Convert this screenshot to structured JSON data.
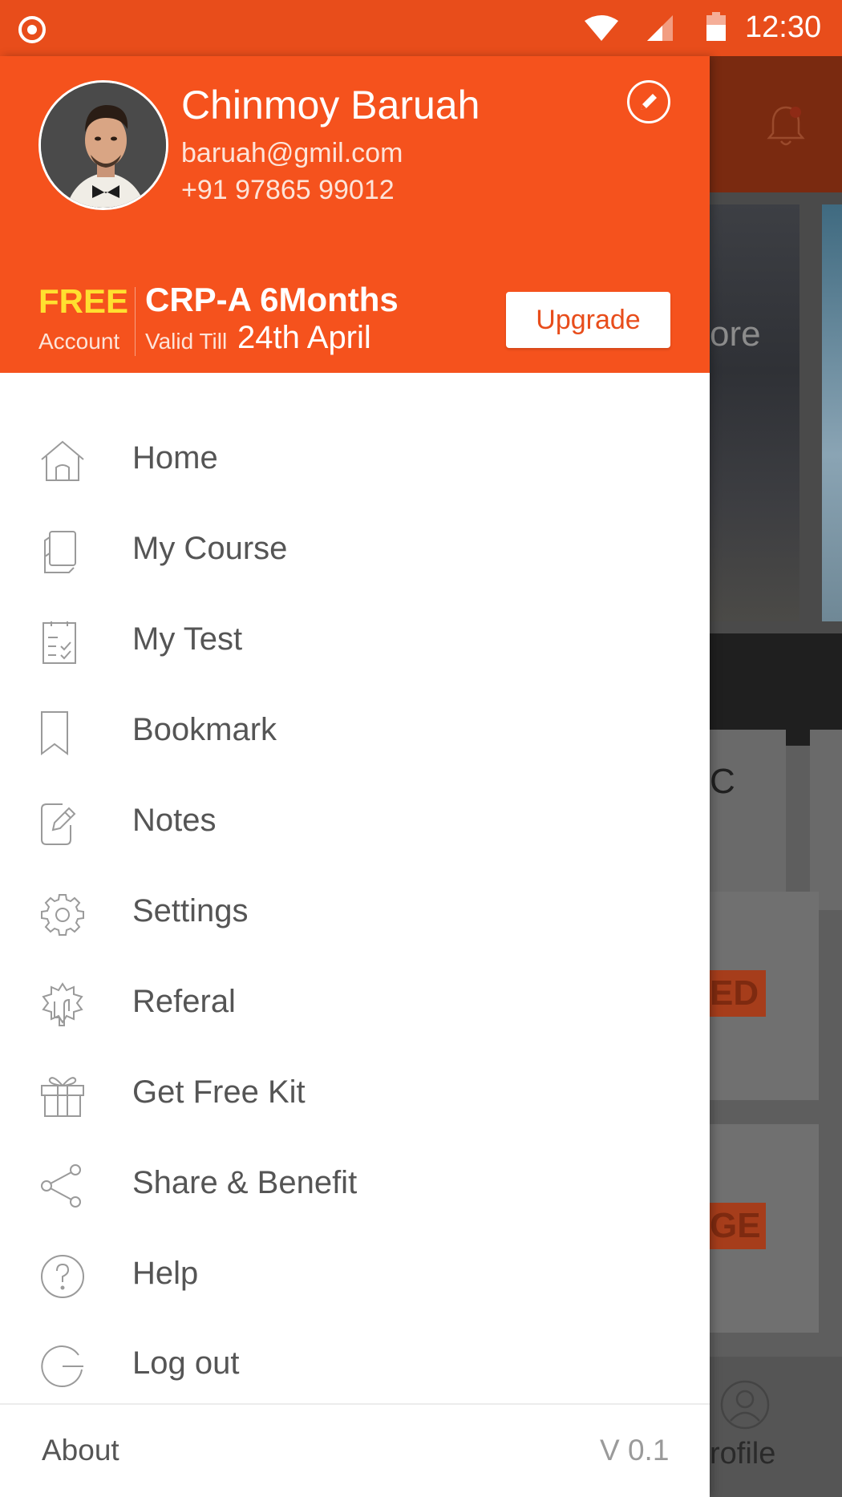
{
  "status_bar": {
    "time": "12:30",
    "icons": [
      "record-icon",
      "wifi-icon",
      "signal-icon",
      "battery-icon"
    ]
  },
  "background_app": {
    "banner_text_fragment": "ore",
    "card_text_fragment": "C",
    "badge_1_fragment": "ED",
    "badge_2_fragment": "GE",
    "bottom_tab_fragment": "rofile"
  },
  "drawer": {
    "user": {
      "name": "Chinmoy Baruah",
      "email": "baruah@gmil.com",
      "phone": "+91 97865 99012"
    },
    "plan": {
      "account_type": "FREE",
      "account_label": "Account",
      "plan_name": "CRP-A 6Months",
      "valid_label": "Valid Till",
      "valid_date": "24th April",
      "upgrade_label": "Upgrade"
    },
    "menu": [
      {
        "label": "Home",
        "icon": "home-icon"
      },
      {
        "label": "My Course",
        "icon": "course-book-icon"
      },
      {
        "label": "My Test",
        "icon": "test-checklist-icon"
      },
      {
        "label": "Bookmark",
        "icon": "bookmark-icon"
      },
      {
        "label": "Notes",
        "icon": "notes-edit-icon"
      },
      {
        "label": "Settings",
        "icon": "gear-icon"
      },
      {
        "label": "Referal",
        "icon": "referral-badge-icon"
      },
      {
        "label": "Get Free Kit",
        "icon": "gift-icon"
      },
      {
        "label": "Share & Benefit",
        "icon": "share-icon"
      },
      {
        "label": "Help",
        "icon": "help-icon"
      },
      {
        "label": "Log out",
        "icon": "logout-icon"
      }
    ],
    "footer": {
      "about_label": "About",
      "version": "V 0.1"
    }
  },
  "colors": {
    "primary": "#f5521d",
    "status_bar": "#e84d1b",
    "free_highlight": "#ffe030",
    "menu_text": "#555555",
    "icon_stroke": "#9a9a9a"
  }
}
